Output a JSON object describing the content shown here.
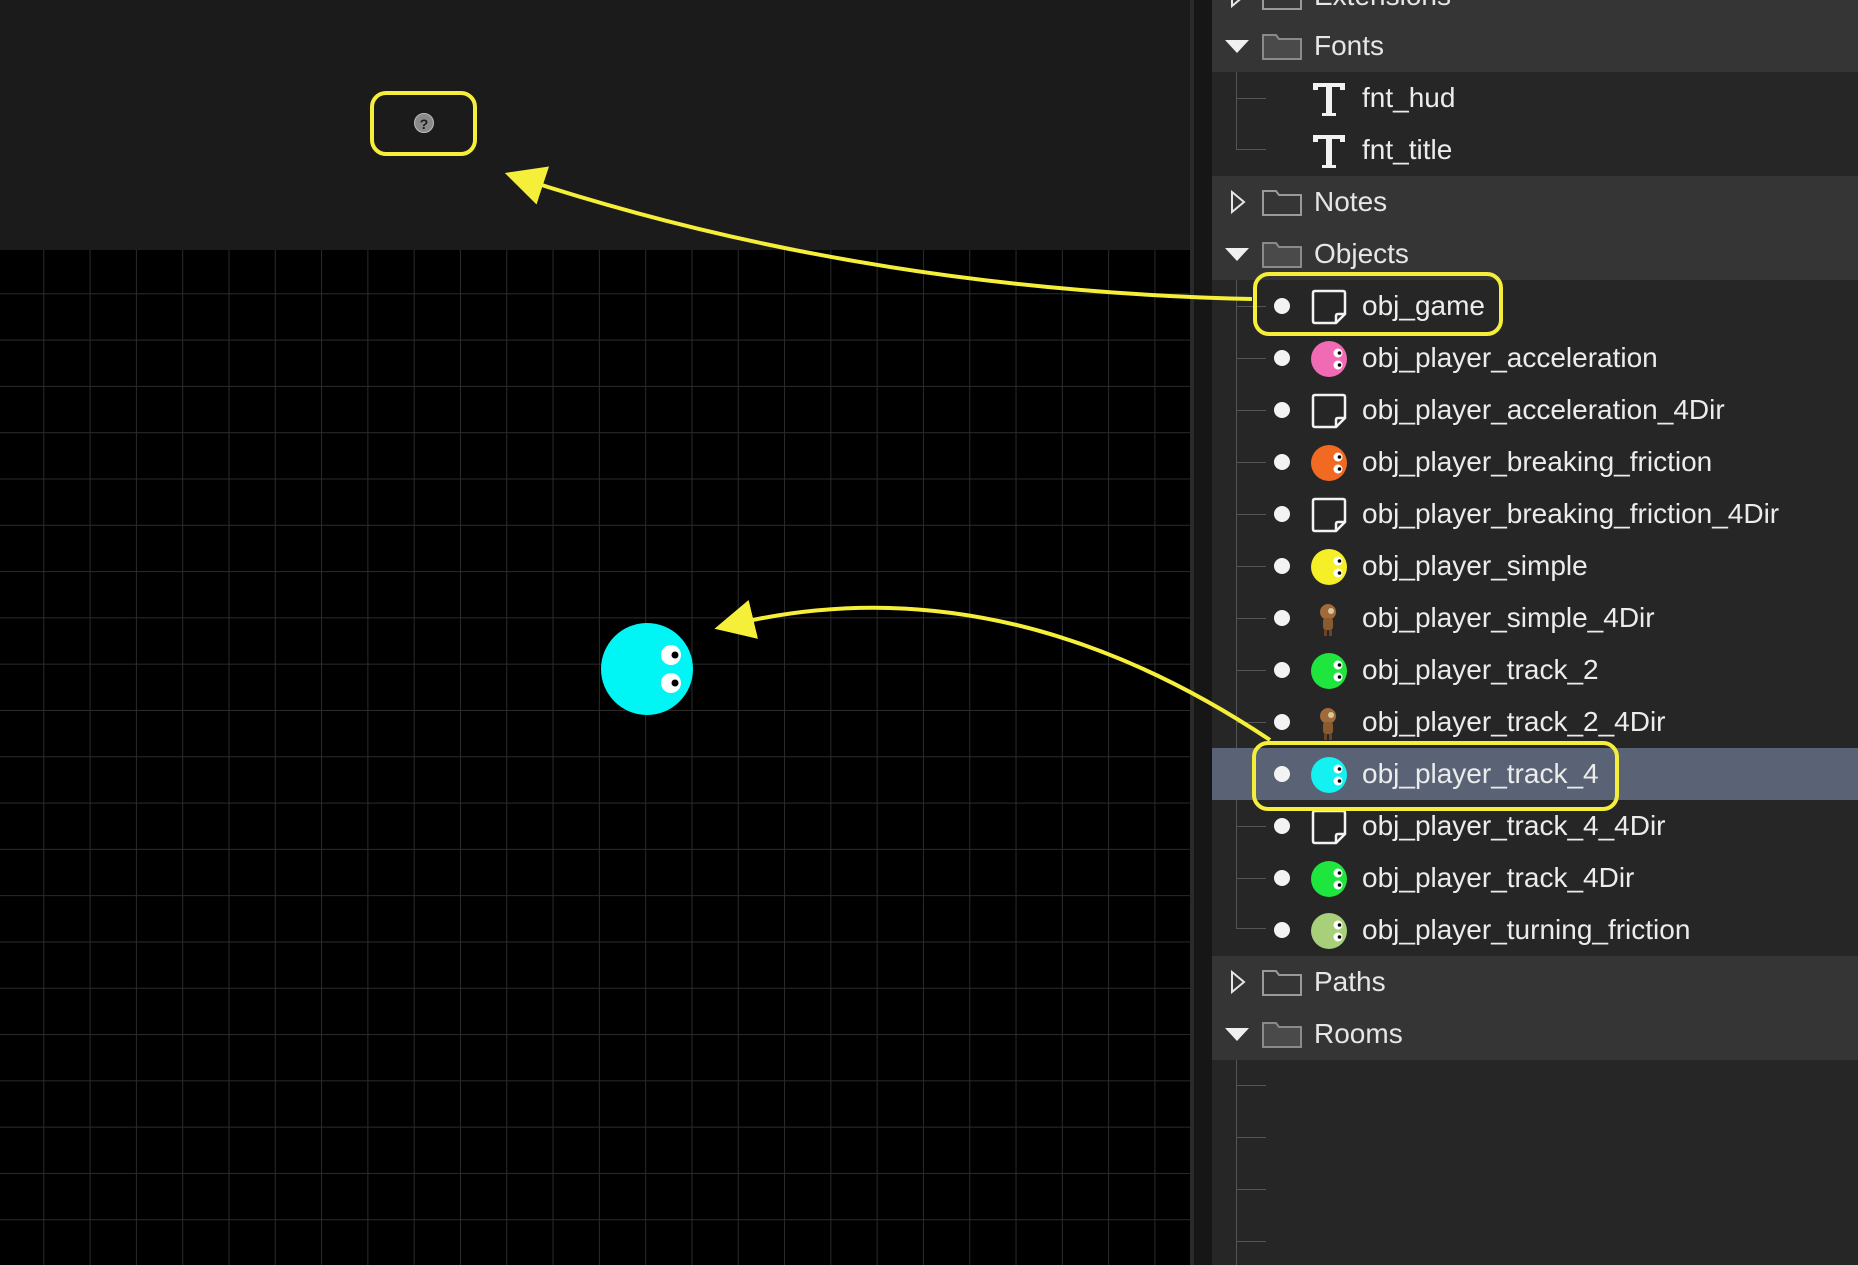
{
  "asset_browser": {
    "folders": {
      "extensions": "Extensions",
      "fonts": "Fonts",
      "notes": "Notes",
      "objects": "Objects",
      "paths": "Paths",
      "rooms": "Rooms"
    },
    "fonts": [
      "fnt_hud",
      "fnt_title"
    ],
    "objects": [
      {
        "label": "obj_game",
        "icon": "blank-sprite-icon"
      },
      {
        "label": "obj_player_acceleration",
        "icon": "pink-face-icon",
        "color": "#f06bb3"
      },
      {
        "label": "obj_player_acceleration_4Dir",
        "icon": "blank-sprite-icon"
      },
      {
        "label": "obj_player_breaking_friction",
        "icon": "orange-face-icon",
        "color": "#f26a21"
      },
      {
        "label": "obj_player_breaking_friction_4Dir",
        "icon": "blank-sprite-icon"
      },
      {
        "label": "obj_player_simple",
        "icon": "yellow-face-icon",
        "color": "#f5ef28"
      },
      {
        "label": "obj_player_simple_4Dir",
        "icon": "character-sprite-icon"
      },
      {
        "label": "obj_player_track_2",
        "icon": "green-face-icon",
        "color": "#1ee63c"
      },
      {
        "label": "obj_player_track_2_4Dir",
        "icon": "character-sprite-icon"
      },
      {
        "label": "obj_player_track_4",
        "icon": "cyan-face-icon",
        "color": "#13f1f1",
        "selected": true
      },
      {
        "label": "obj_player_track_4_4Dir",
        "icon": "blank-sprite-icon"
      },
      {
        "label": "obj_player_track_4Dir",
        "icon": "green-face-icon",
        "color": "#1ee63c"
      },
      {
        "label": "obj_player_turning_friction",
        "icon": "olive-face-icon",
        "color": "#a8cf7a"
      }
    ]
  },
  "room": {
    "unknown_object_glyph": "?",
    "player_color": "#00f5f5"
  },
  "colors": {
    "highlight": "#f5ef3a",
    "selection": "#5a6376",
    "folder_row": "#353535"
  }
}
